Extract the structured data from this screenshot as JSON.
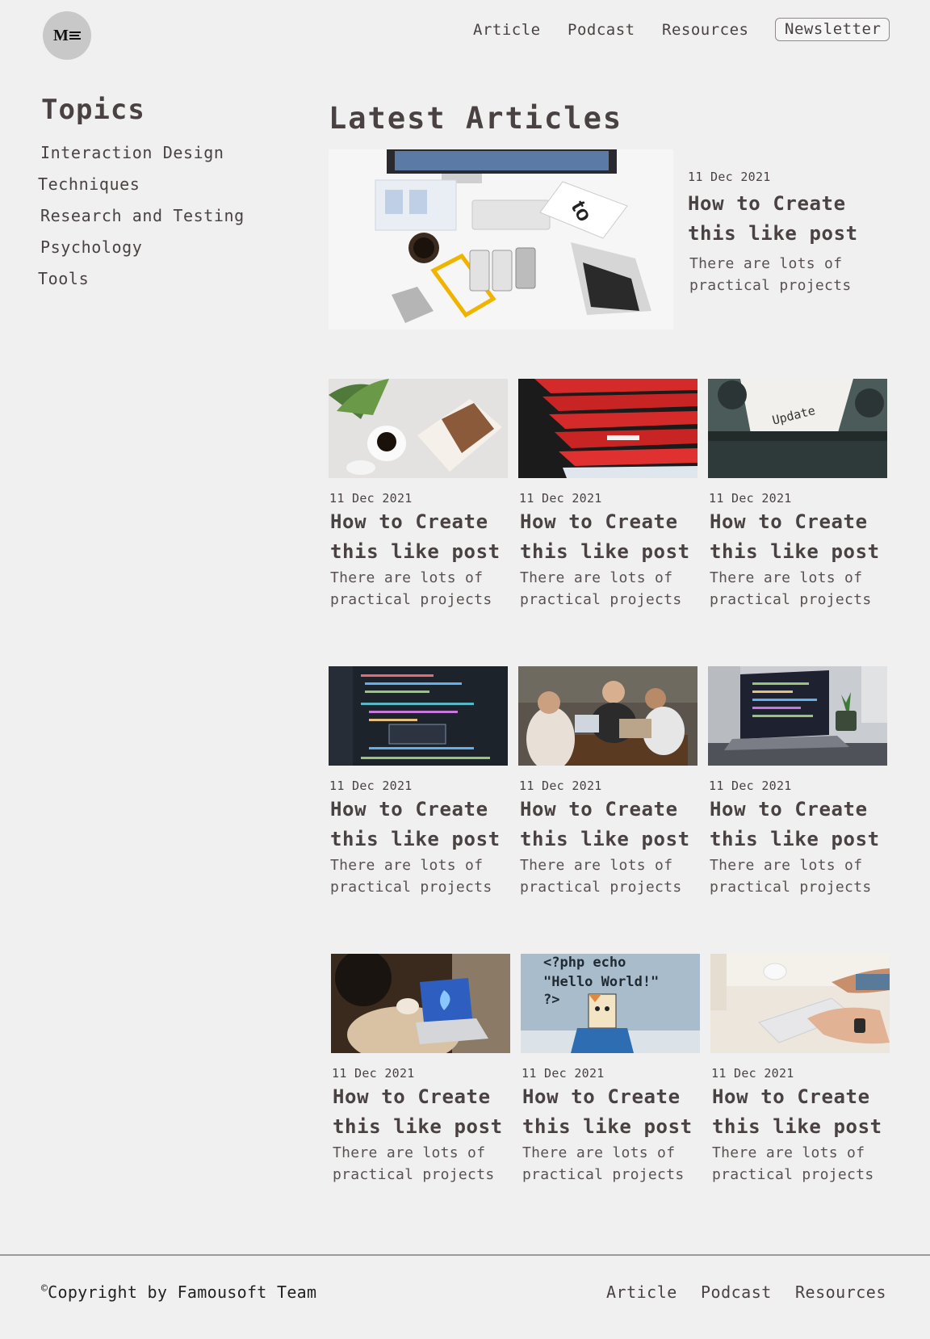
{
  "header": {
    "logo_text": "M",
    "nav": [
      "Article",
      "Podcast",
      "Resources"
    ],
    "newsletter_label": "Newsletter"
  },
  "sidebar": {
    "title": "Topics",
    "items": [
      "Interaction Design",
      "Techniques",
      "Research and Testing",
      "Psychology",
      "Tools"
    ]
  },
  "main": {
    "title": "Latest Articles",
    "featured": {
      "date": "11 Dec 2021",
      "title_line1": "How to Create",
      "title_line2": "this like post",
      "excerpt_line1": "There are lots of",
      "excerpt_line2": "practical projects",
      "image": "desk-flatlay-image"
    },
    "cards": [
      {
        "date": "11 Dec 2021",
        "title_line1": "How to Create",
        "title_line2": "this like post",
        "excerpt_line1": "There are lots of",
        "excerpt_line2": "practical projects",
        "image": "coffee-magazine-image"
      },
      {
        "date": "11 Dec 2021",
        "title_line1": "How to Create",
        "title_line2": "this like post",
        "excerpt_line1": "There are lots of",
        "excerpt_line2": "practical projects",
        "image": "red-books-image"
      },
      {
        "date": "11 Dec 2021",
        "title_line1": "How to Create",
        "title_line2": "this like post",
        "excerpt_line1": "There are lots of",
        "excerpt_line2": "practical projects",
        "image": "typewriter-update-image"
      },
      {
        "date": "11 Dec 2021",
        "title_line1": "How to Create",
        "title_line2": "this like post",
        "excerpt_line1": "There are lots of",
        "excerpt_line2": "practical projects",
        "image": "code-editor-image"
      },
      {
        "date": "11 Dec 2021",
        "title_line1": "How to Create",
        "title_line2": "this like post",
        "excerpt_line1": "There are lots of",
        "excerpt_line2": "practical projects",
        "image": "people-laptop-image"
      },
      {
        "date": "11 Dec 2021",
        "title_line1": "How to Create",
        "title_line2": "this like post",
        "excerpt_line1": "There are lots of",
        "excerpt_line2": "practical projects",
        "image": "laptop-code-image"
      },
      {
        "date": "11 Dec 2021",
        "title_line1": "How to Create",
        "title_line2": "this like post",
        "excerpt_line1": "There are lots of",
        "excerpt_line2": "practical projects",
        "image": "windows-laptop-image"
      },
      {
        "date": "11 Dec 2021",
        "title_line1": "How to Create",
        "title_line2": "this like post",
        "excerpt_line1": "There are lots of",
        "excerpt_line2": "practical projects",
        "image": "php-hello-world-image"
      },
      {
        "date": "11 Dec 2021",
        "title_line1": "How to Create",
        "title_line2": "this like post",
        "excerpt_line1": "There are lots of",
        "excerpt_line2": "practical projects",
        "image": "keyboard-typing-image"
      }
    ],
    "php_text": {
      "line1": "<?php echo",
      "line2": "\"Hello World!\"",
      "line3": "?>"
    },
    "typewriter_text": "Update"
  },
  "footer": {
    "copyright_symbol": "©",
    "copyright": "Copyright by Famousoft Team",
    "nav": [
      "Article",
      "Podcast",
      "Resources"
    ]
  }
}
